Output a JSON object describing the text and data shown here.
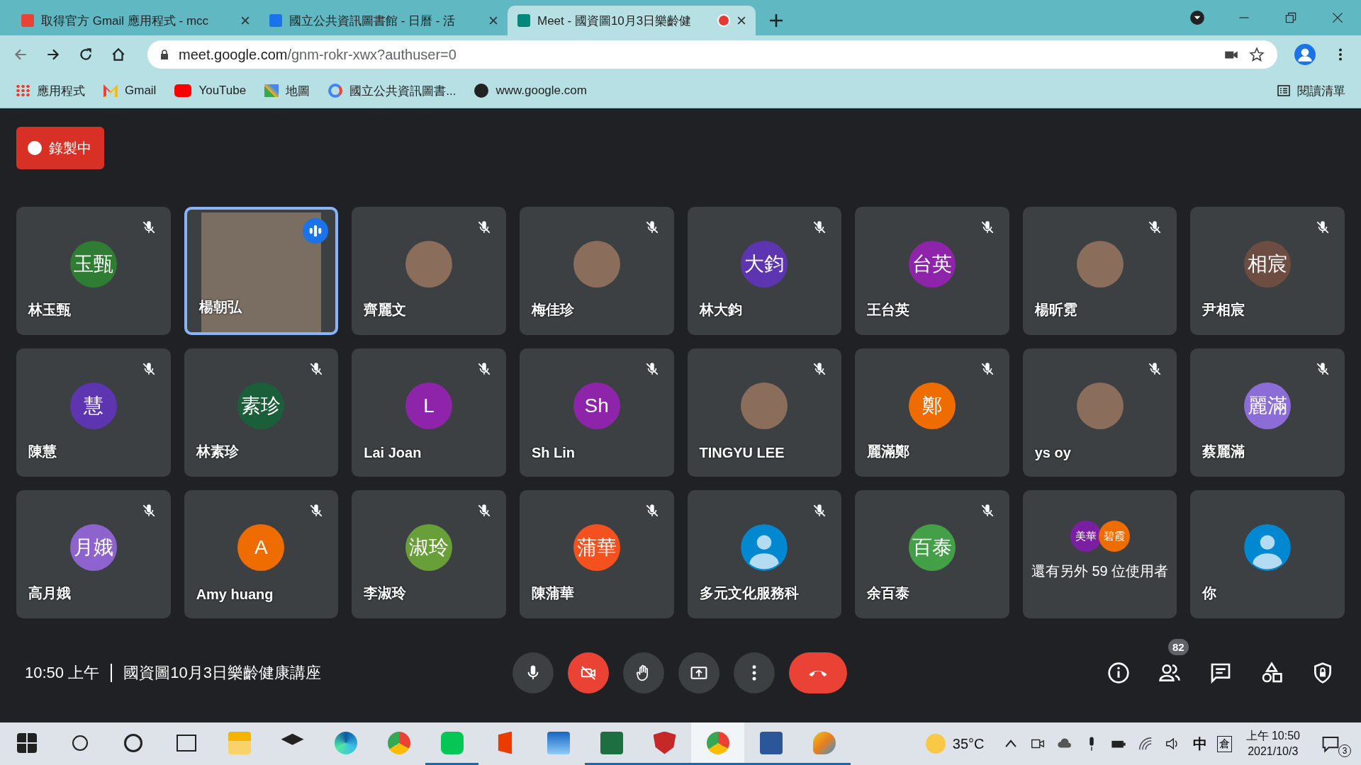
{
  "browser": {
    "tabs": [
      {
        "title": "取得官方 Gmail 應用程式 - mcc",
        "selected": false,
        "recording": false
      },
      {
        "title": "國立公共資訊圖書館 - 日曆 - 活",
        "selected": false,
        "recording": false
      },
      {
        "title": "Meet - 國資圖10月3日樂齡健",
        "selected": true,
        "recording": true
      }
    ],
    "address_host": "meet.google.com",
    "address_path": "/gnm-rokr-xwx?authuser=0",
    "bookmarks": [
      "應用程式",
      "Gmail",
      "YouTube",
      "地圖",
      "國立公共資訊圖書...",
      "www.google.com"
    ],
    "reading_list": "閱讀清單"
  },
  "meeting": {
    "recording_label": "錄製中",
    "tiles": [
      {
        "kind": "initials",
        "name": "林玉甄",
        "initials": "玉甄",
        "color": "#2e7d32",
        "muted": true,
        "speaking": false
      },
      {
        "kind": "video",
        "name": "楊朝弘",
        "muted": false,
        "speaking": true
      },
      {
        "kind": "photo",
        "name": "齊麗文",
        "muted": true,
        "speaking": false
      },
      {
        "kind": "photo",
        "name": "梅佳珍",
        "muted": true,
        "speaking": false
      },
      {
        "kind": "initials",
        "name": "林大鈞",
        "initials": "大鈞",
        "color": "#5e35b1",
        "muted": true,
        "speaking": false
      },
      {
        "kind": "initials",
        "name": "王台英",
        "initials": "台英",
        "color": "#8e24aa",
        "muted": true,
        "speaking": false
      },
      {
        "kind": "photo",
        "name": "楊昕霓",
        "muted": true,
        "speaking": false
      },
      {
        "kind": "initials",
        "name": "尹相宸",
        "initials": "相宸",
        "color": "#6d4c41",
        "muted": true,
        "speaking": false
      },
      {
        "kind": "initials",
        "name": "陳慧",
        "initials": "慧",
        "color": "#5e35b1",
        "muted": true,
        "speaking": false
      },
      {
        "kind": "initials",
        "name": "林素珍",
        "initials": "素珍",
        "color": "#1b5e3a",
        "muted": true,
        "speaking": false
      },
      {
        "kind": "initials",
        "name": "Lai Joan",
        "initials": "L",
        "color": "#8e24aa",
        "muted": true,
        "speaking": false
      },
      {
        "kind": "initials",
        "name": "Sh Lin",
        "initials": "Sh",
        "color": "#8e24aa",
        "muted": true,
        "speaking": false
      },
      {
        "kind": "photo",
        "name": "TINGYU LEE",
        "muted": true,
        "speaking": false
      },
      {
        "kind": "initials",
        "name": "麗滿鄭",
        "initials": "鄭",
        "color": "#ef6c00",
        "muted": true,
        "speaking": false
      },
      {
        "kind": "photo",
        "name": "ys oy",
        "muted": true,
        "speaking": false
      },
      {
        "kind": "initials",
        "name": "蔡麗滿",
        "initials": "麗滿",
        "color": "#8c6dd8",
        "muted": true,
        "speaking": false
      },
      {
        "kind": "initials",
        "name": "高月娥",
        "initials": "月娥",
        "color": "#8e63ce",
        "muted": true,
        "speaking": false
      },
      {
        "kind": "initials",
        "name": "Amy huang",
        "initials": "A",
        "color": "#ef6c00",
        "muted": true,
        "speaking": false
      },
      {
        "kind": "initials",
        "name": "李淑玲",
        "initials": "淑玲",
        "color": "#689f38",
        "muted": true,
        "speaking": false
      },
      {
        "kind": "initials",
        "name": "陳蒲華",
        "initials": "蒲華",
        "color": "#f4511e",
        "muted": true,
        "speaking": false
      },
      {
        "kind": "generic",
        "name": "多元文化服務科",
        "muted": true,
        "speaking": false
      },
      {
        "kind": "initials",
        "name": "余百泰",
        "initials": "百泰",
        "color": "#43a047",
        "muted": true,
        "speaking": false
      },
      {
        "kind": "more",
        "label": "還有另外 59 位使用者",
        "avatars": [
          {
            "initials": "美華",
            "color": "#7b1fa2"
          },
          {
            "initials": "碧霞",
            "color": "#ef6c00"
          }
        ]
      },
      {
        "kind": "generic",
        "name": "你",
        "muted": false,
        "speaking": false
      }
    ],
    "time": "10:50 上午",
    "title": "國資圖10月3日樂齡健康講座",
    "camera_on": false,
    "participant_count": "82"
  },
  "taskbar": {
    "apps": [
      {
        "open": false,
        "selected": false
      },
      {
        "open": false,
        "selected": false
      },
      {
        "open": false,
        "selected": false
      },
      {
        "open": false,
        "selected": false
      },
      {
        "open": false,
        "selected": false
      },
      {
        "open": false,
        "selected": false
      },
      {
        "open": false,
        "selected": false
      },
      {
        "open": false,
        "selected": false
      },
      {
        "open": true,
        "selected": false
      },
      {
        "open": false,
        "selected": false
      },
      {
        "open": false,
        "selected": false
      },
      {
        "open": true,
        "selected": false
      },
      {
        "open": true,
        "selected": false
      },
      {
        "open": true,
        "selected": true
      },
      {
        "open": true,
        "selected": false
      },
      {
        "open": true,
        "selected": false
      }
    ],
    "weather": "35°C",
    "ime_mode": "中",
    "ime": "倉",
    "time": "上午 10:50",
    "date": "2021/10/3",
    "notifications": "3"
  }
}
